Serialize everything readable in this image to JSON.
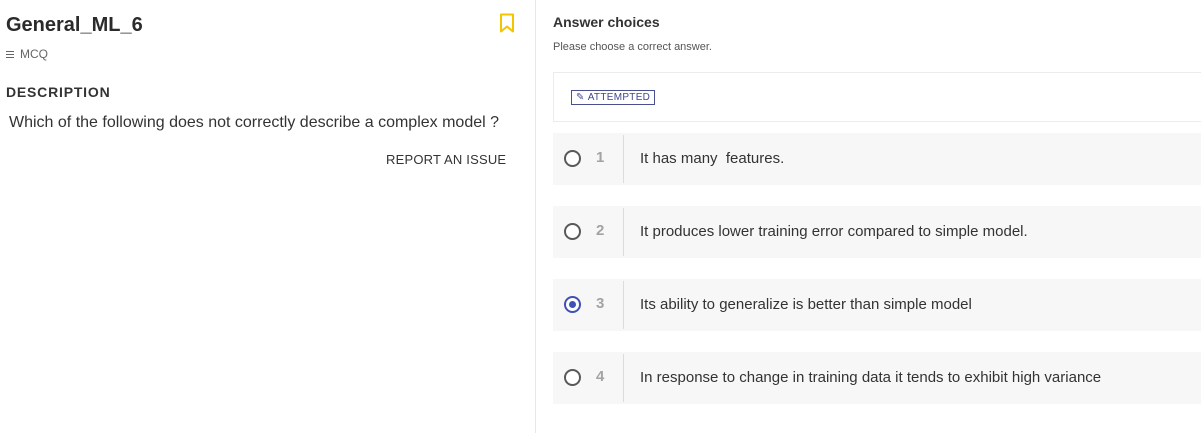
{
  "question": {
    "title": "General_ML_6",
    "type_label": "MCQ",
    "description_heading": "DESCRIPTION",
    "description_text": "Which of the following does not correctly describe a complex model ?",
    "report_label": "REPORT AN ISSUE",
    "bookmark_icon": "bookmark-icon",
    "bookmark_color": "#f5c400"
  },
  "answers": {
    "heading": "Answer choices",
    "subheading": "Please choose a correct answer.",
    "status_label": "ATTEMPTED",
    "accent_color": "#3f51b5",
    "selected_option": 3,
    "options": [
      {
        "number": "1",
        "text": "It has many  features."
      },
      {
        "number": "2",
        "text": "It produces lower training error compared to simple model."
      },
      {
        "number": "3",
        "text": "Its ability to generalize is better than simple model"
      },
      {
        "number": "4",
        "text": "In response to change in training data it tends to exhibit high variance"
      }
    ]
  }
}
